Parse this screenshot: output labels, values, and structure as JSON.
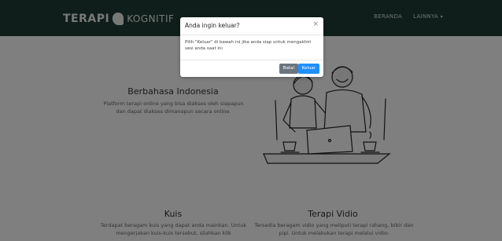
{
  "navbar": {
    "brand_part1": "TERAPI",
    "brand_part2": "KOGNITIF",
    "links": [
      "BERANDA",
      "LAINNYA"
    ],
    "dropdown_caret": "▾"
  },
  "hero": {
    "title": "Berbahasa Indonesia",
    "text": "Platform terapi online yang bisa diakses oleh siapapun dan dapat diakses dimanapun secara online."
  },
  "features": [
    {
      "title": "Kuis",
      "text": "Terdapat beragam kuis yang dapat anda mainkan. Untuk mengerjakan kuis-kuis tersebut, silahkan klik"
    },
    {
      "title": "Terapi Vidio",
      "text": "Tersedia beragam vidio yang meliputi terapi rahang, bibir dan pipi. Untuk melakukan terapi melalui vidio-"
    }
  ],
  "modal": {
    "title": "Anda ingin keluar?",
    "close": "×",
    "body": "Pilih \"Keluar\" di bawah ini jika anda siap untuk mengakhiri sesi anda saat ini",
    "cancel": "Batal",
    "confirm": "Keluar"
  },
  "colors": {
    "navbar": "#1f3d34",
    "overlay": "rgba(0,0,0,0.5)",
    "primary": "#1e90ff",
    "secondary": "#6c757d"
  }
}
